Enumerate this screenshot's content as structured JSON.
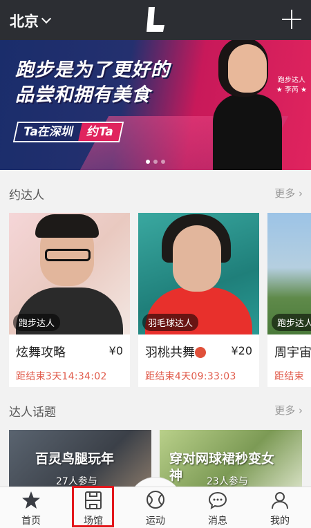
{
  "header": {
    "city": "北京"
  },
  "banner": {
    "headline_line1": "跑步是为了更好的",
    "headline_line2": "品尝和拥有美食",
    "tag_left": "Ta在深圳",
    "tag_right": "约Ta",
    "caption_line1": "跑步达人",
    "caption_line2": "★ 李芮 ★",
    "slides": 3,
    "active_slide": 1
  },
  "experts": {
    "title": "约达人",
    "more": "更多 ›",
    "cards": [
      {
        "badge": "跑步达人",
        "title": "炫舞攻略",
        "price": "¥0",
        "timer": "距结束3天14:34:02"
      },
      {
        "badge": "羽毛球达人",
        "title": "羽桃共舞",
        "price": "¥20",
        "timer": "距结束4天09:33:03"
      },
      {
        "badge": "跑步达人",
        "title": "周宇宙",
        "price": "",
        "timer": "距结束"
      }
    ]
  },
  "topics": {
    "title": "达人话题",
    "more": "更多 ›",
    "items": [
      {
        "title": "百灵鸟腿玩年",
        "count": "27人参与"
      },
      {
        "title_line1": "穿对网球裙秒变女",
        "title_line2": "神",
        "count": "23人参与"
      }
    ]
  },
  "tabs": [
    {
      "label": "首页",
      "icon": "star-icon"
    },
    {
      "label": "场馆",
      "icon": "venue-icon"
    },
    {
      "label": "运动",
      "icon": "tennis-ball-icon"
    },
    {
      "label": "消息",
      "icon": "chat-bubble-icon"
    },
    {
      "label": "我的",
      "icon": "user-icon"
    }
  ],
  "colors": {
    "header_bg": "#2c2e33",
    "timer": "#e05a4a",
    "highlight": "#e3171c",
    "banner_pink": "#e0245e",
    "banner_navy": "#1d2a66"
  }
}
